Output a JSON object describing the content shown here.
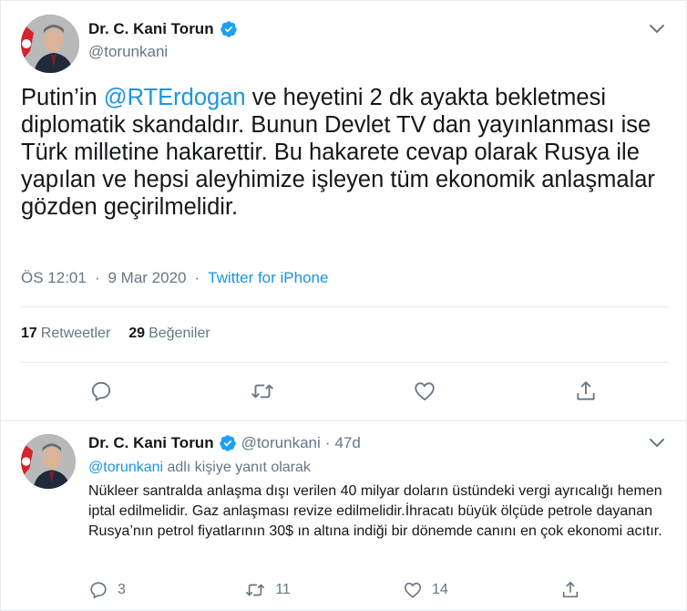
{
  "main_tweet": {
    "display_name": "Dr. C. Kani Torun",
    "handle": "@torunkani",
    "text_segments": {
      "before": "Putin’in ",
      "mention": "@RTErdogan",
      "after": " ve heyetini 2 dk ayakta bekletmesi diplomatik skandaldır. Bunun Devlet TV dan yayınlanması ise Türk milletine hakarettir. Bu hakarete cevap olarak Rusya ile yapılan ve hepsi aleyhimize işleyen tüm ekonomik anlaşmalar gözden geçirilmelidir."
    },
    "time": "ÖS 12:01",
    "date": "9 Mar 2020",
    "separator": "·",
    "source": "Twitter for iPhone",
    "stats": {
      "retweets_count": "17",
      "retweets_label": "Retweetler",
      "likes_count": "29",
      "likes_label": "Beğeniler"
    },
    "action_icons": [
      "reply-icon",
      "retweet-icon",
      "like-icon",
      "share-icon"
    ]
  },
  "reply_tweet": {
    "display_name": "Dr. C. Kani Torun",
    "handle": "@torunkani",
    "dot": "·",
    "time": "47d",
    "replying_mention": "@torunkani",
    "replying_text": " adlı kişiye yanıt olarak",
    "text": "Nükleer santralda anlaşma dışı verilen 40 milyar doların üstündeki vergi ayrıcalığı hemen iptal edilmelidir. Gaz anlaşması revize edilmelidir.İhracatı büyük ölçüde petrole dayanan Rusya’nın petrol fiyatlarının 30$ ın altına indiği bir dönemde canını en çok ekonomi acıtır.",
    "reply_count": "3",
    "retweet_count": "11",
    "like_count": "14"
  },
  "colors": {
    "accent": "#1b95e0",
    "secondary_text": "#657786",
    "primary_text": "#14171a",
    "divider": "#e6ecf0"
  }
}
